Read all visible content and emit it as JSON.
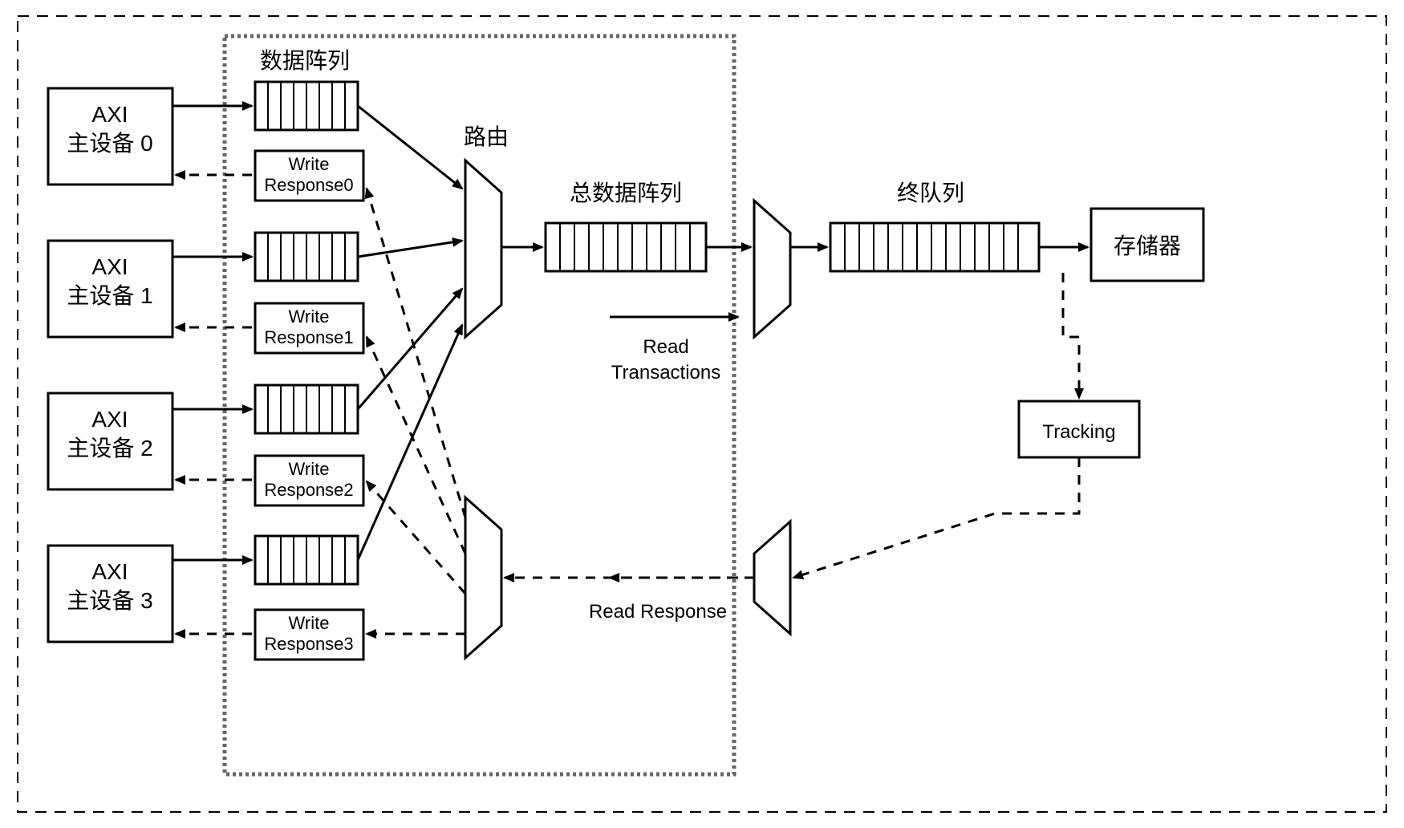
{
  "masters": [
    {
      "line1": "AXI",
      "line2": "主设备 0"
    },
    {
      "line1": "AXI",
      "line2": "主设备 1"
    },
    {
      "line1": "AXI",
      "line2": "主设备 2"
    },
    {
      "line1": "AXI",
      "line2": "主设备 3"
    }
  ],
  "write_responses": [
    {
      "line1": "Write",
      "line2": "Response0"
    },
    {
      "line1": "Write",
      "line2": "Response1"
    },
    {
      "line1": "Write",
      "line2": "Response2"
    },
    {
      "line1": "Write",
      "line2": "Response3"
    }
  ],
  "labels": {
    "data_array": "数据阵列",
    "router": "路由",
    "main_queue": "总数据阵列",
    "read_tx_line1": "Read",
    "read_tx_line2": "Transactions",
    "read_resp": "Read Response",
    "final_queue": "终队列",
    "memory": "存储器",
    "tracking": "Tracking"
  }
}
